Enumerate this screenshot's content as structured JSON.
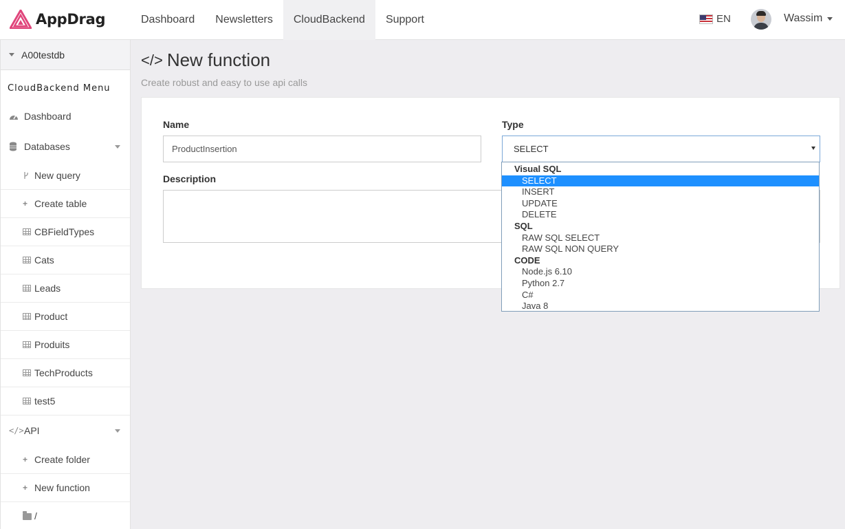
{
  "brand": {
    "name": "AppDrag"
  },
  "nav": [
    {
      "label": "Dashboard",
      "active": false
    },
    {
      "label": "Newsletters",
      "active": false
    },
    {
      "label": "CloudBackend",
      "active": true
    },
    {
      "label": "Support",
      "active": false
    }
  ],
  "language": "EN",
  "user": {
    "name": "Wassim"
  },
  "sidebar": {
    "database": "A00testdb",
    "menu_title": "CloudBackend Menu",
    "dashboard": "Dashboard",
    "databases": "Databases",
    "db_items": [
      "New query",
      "Create table",
      "CBFieldTypes",
      "Cats",
      "Leads",
      "Product",
      "Produits",
      "TechProducts",
      "test5"
    ],
    "api": "API",
    "api_items": [
      "Create folder",
      "New function",
      "/"
    ]
  },
  "page": {
    "title": "New function",
    "subtitle": "Create robust and easy to use api calls"
  },
  "form": {
    "name_label": "Name",
    "name_value": "ProductInsertion",
    "type_label": "Type",
    "type_value": "SELECT",
    "description_label": "Description",
    "description_value": ""
  },
  "type_options": [
    {
      "group": "Visual SQL",
      "options": [
        "SELECT",
        "INSERT",
        "UPDATE",
        "DELETE"
      ]
    },
    {
      "group": "SQL",
      "options": [
        "RAW SQL SELECT",
        "RAW SQL NON QUERY"
      ]
    },
    {
      "group": "CODE",
      "options": [
        "Node.js 6.10",
        "Python 2.7",
        "C#",
        "Java 8"
      ]
    }
  ],
  "colors": {
    "brand": "#e0457b",
    "selected_option": "#1e90ff",
    "page_background": "#eeedf0"
  }
}
